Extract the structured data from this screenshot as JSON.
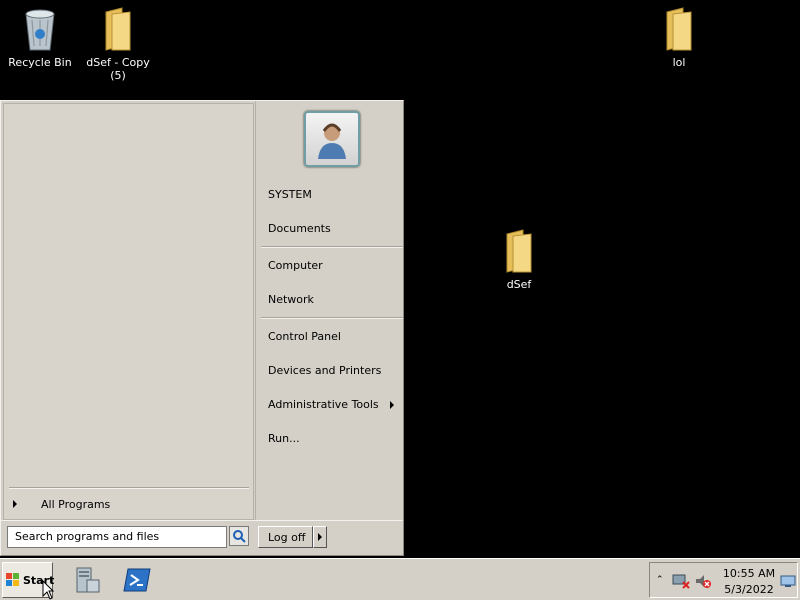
{
  "desktop": {
    "icons": [
      {
        "label": "Recycle Bin",
        "icon": "recycle-bin-icon"
      },
      {
        "label": "dSef - Copy (5)",
        "icon": "folder-icon"
      },
      {
        "label": "lol",
        "icon": "folder-icon"
      },
      {
        "label": "dSef",
        "icon": "folder-icon"
      }
    ]
  },
  "start_menu": {
    "all_programs": "All Programs",
    "search_placeholder": "Search programs and files",
    "logoff_label": "Log off",
    "user_icon": "user-avatar-icon",
    "right_items": [
      {
        "label": "SYSTEM"
      },
      {
        "label": "Documents"
      },
      {
        "label": "Computer"
      },
      {
        "label": "Network"
      },
      {
        "label": "Control Panel"
      },
      {
        "label": "Devices and Printers"
      },
      {
        "label": "Administrative Tools"
      },
      {
        "label": "Run..."
      }
    ]
  },
  "taskbar": {
    "start_label": "Start",
    "pinned": [
      {
        "name": "server-manager-icon"
      },
      {
        "name": "powershell-icon"
      }
    ],
    "tray": {
      "time": "10:55 AM",
      "date": "5/3/2022",
      "icons": [
        "show-hidden-icons",
        "network-disconnected-icon",
        "volume-muted-icon",
        "show-desktop-icon"
      ]
    }
  },
  "colors": {
    "desktop_bg": "#000000",
    "menu_bg": "#d4d0c8",
    "folder_yellow": "#f2d27a"
  }
}
